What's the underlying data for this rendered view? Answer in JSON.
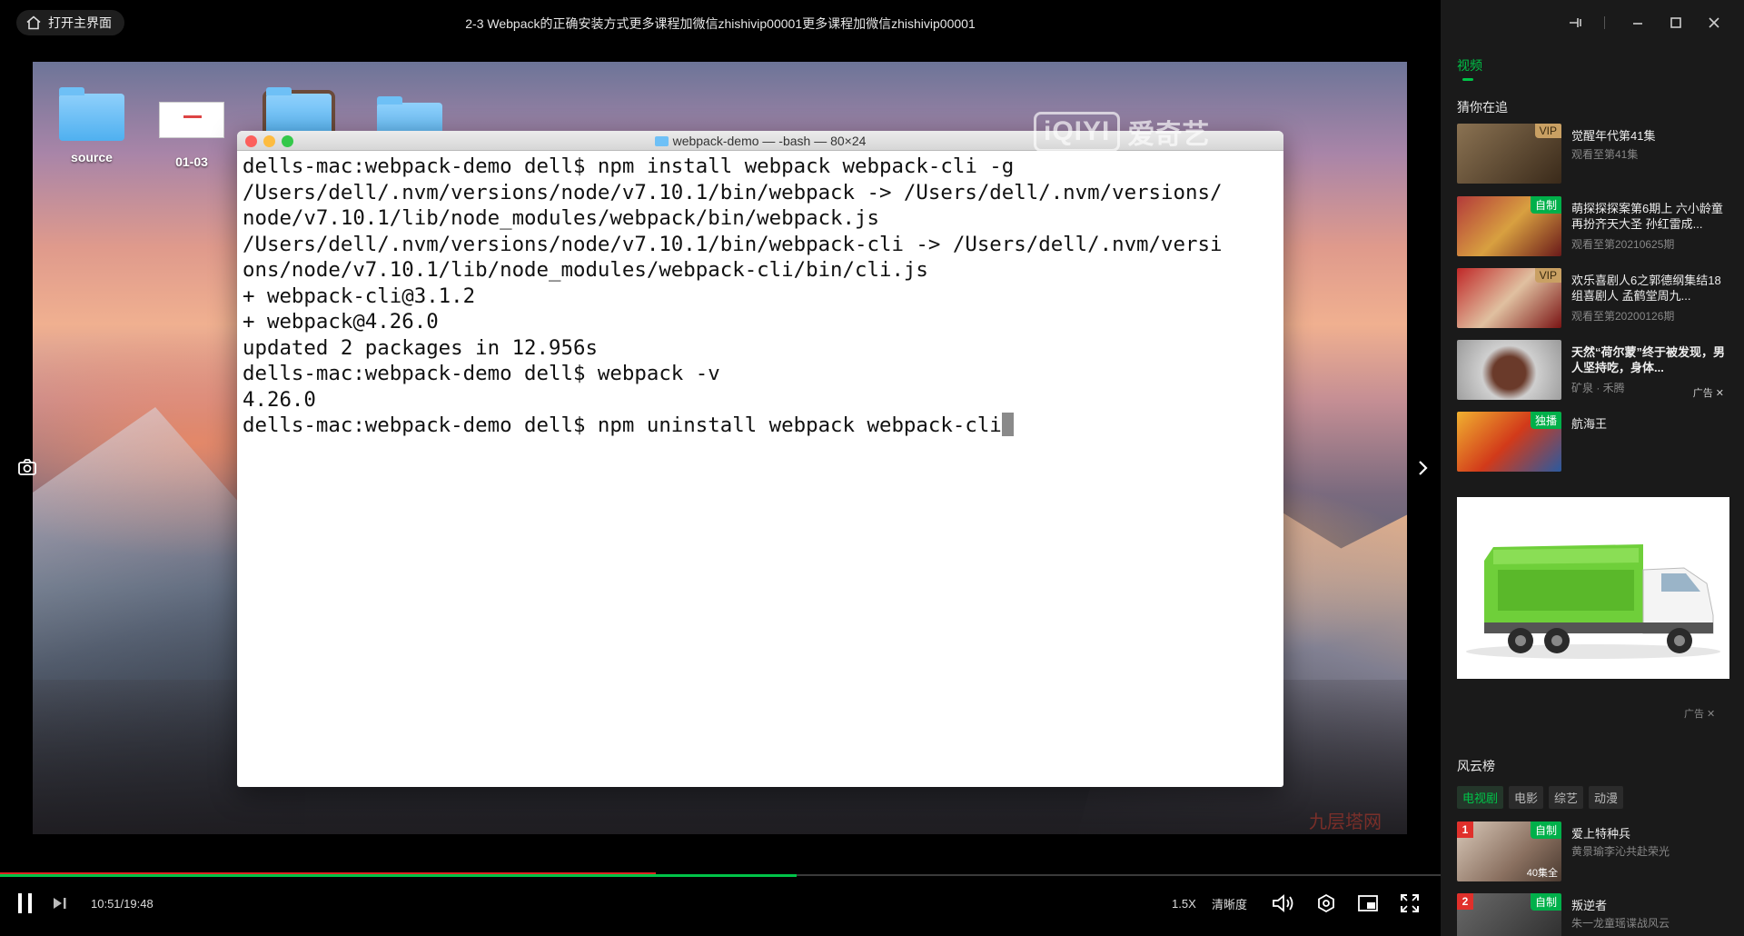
{
  "player": {
    "home_label": "打开主界面",
    "title": "2-3 Webpack的正确安装方式更多课程加微信zhishivip00001更多课程加微信zhishivip00001",
    "time_current": "10:51",
    "time_separator": " / ",
    "time_total": "19:48",
    "speed": "1.5X",
    "quality": "清晰度",
    "progress_played_fraction": 0.553,
    "progress_buffered_fraction": 0.455
  },
  "desktop": {
    "icons": [
      {
        "label": "source"
      },
      {
        "label": "01-03"
      }
    ]
  },
  "terminal": {
    "title": "webpack-demo — -bash — 80×24",
    "lines": [
      "dells-mac:webpack-demo dell$ npm install webpack webpack-cli -g",
      "/Users/dell/.nvm/versions/node/v7.10.1/bin/webpack -> /Users/dell/.nvm/versions/",
      "node/v7.10.1/lib/node_modules/webpack/bin/webpack.js",
      "/Users/dell/.nvm/versions/node/v7.10.1/bin/webpack-cli -> /Users/dell/.nvm/versi",
      "ons/node/v7.10.1/lib/node_modules/webpack-cli/bin/cli.js",
      "+ webpack-cli@3.1.2",
      "+ webpack@4.26.0",
      "updated 2 packages in 12.956s",
      "dells-mac:webpack-demo dell$ webpack -v",
      "4.26.0",
      "dells-mac:webpack-demo dell$ npm uninstall webpack webpack-cli"
    ]
  },
  "watermark": {
    "logo": "iQIYI",
    "text": "爱奇艺",
    "corner": "九层塔网"
  },
  "sidebar": {
    "tab": "视频",
    "recommend_heading": "猜你在追",
    "recommend": [
      {
        "title": "觉醒年代第41集",
        "sub": "观看至第41集",
        "badge": "VIP",
        "badge_type": "vip",
        "thumb_color": "#5a4632"
      },
      {
        "title": "萌探探探案第6期上 六小龄童再扮齐天大圣 孙红雷成...",
        "sub": "观看至第20210625期",
        "badge": "自制",
        "badge_type": "zz",
        "thumb_color": "#8b2020"
      },
      {
        "title": "欢乐喜剧人6之郭德纲集结18组喜剧人 孟鹤堂周九...",
        "sub": "观看至第20200126期",
        "badge": "VIP",
        "badge_type": "vip",
        "thumb_color": "#9a2222"
      },
      {
        "title": "天然“荷尔蒙”终于被发现，男人坚持吃，身体...",
        "sub": "矿泉 · 禾腾",
        "ad": "广告",
        "thumb_color": "#6a6060"
      },
      {
        "title": "航海王",
        "badge": "独播",
        "badge_type": "zz",
        "thumb_color": "#c83a1f"
      }
    ],
    "ad_label": "广告",
    "rank_heading": "风云榜",
    "rank_tabs": [
      "电视剧",
      "电影",
      "综艺",
      "动漫"
    ],
    "rank": [
      {
        "num": "1",
        "title": "爱上特种兵",
        "sub": "黄景瑜李沁共赴荣光",
        "badge": "自制",
        "extra": "40集全",
        "thumb_color": "#7a6a5a"
      },
      {
        "num": "2",
        "title": "叛逆者",
        "sub": "朱一龙童瑶谍战风云",
        "badge": "自制",
        "thumb_color": "#3a3a3a"
      }
    ]
  },
  "colors": {
    "accent": "#00c348",
    "buffer": "#dd2222",
    "sidebar_bg": "#1a1a1a"
  }
}
